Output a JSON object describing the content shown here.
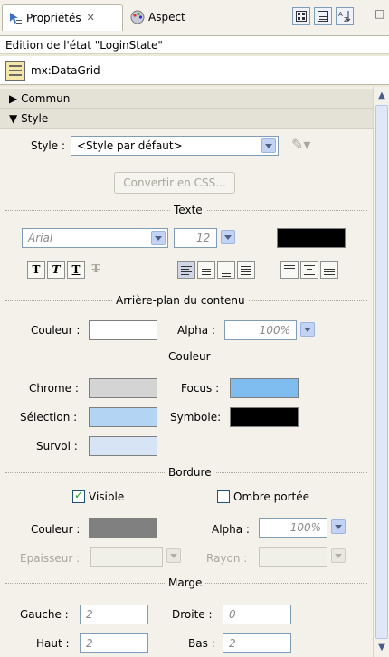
{
  "tabs": [
    {
      "label": "Propriétés",
      "icon": "properties-icon",
      "close_glyph": "✕"
    },
    {
      "label": "Aspect",
      "icon": "appearance-icon"
    }
  ],
  "toolbar_icons": [
    "standard-view-icon",
    "category-view-icon",
    "alpha-sort-icon"
  ],
  "window_controls": {
    "minimize": "–",
    "maximize": "□"
  },
  "state_label": "Edition de l'état  \"LoginState\"",
  "component": {
    "name": "mx:DataGrid",
    "icon": "datagrid-icon"
  },
  "sections": {
    "commun": "Commun",
    "style": "Style"
  },
  "style_row": {
    "label": "Style :",
    "value": "<Style par défaut>"
  },
  "convert_button": "Convertir en CSS...",
  "text_group": {
    "header": "Texte",
    "font": "Arial",
    "size": "12",
    "color": "#000000",
    "format_buttons": [
      "T",
      "T",
      "T",
      "T"
    ]
  },
  "bg_group": {
    "header": "Arrière-plan du contenu",
    "color_label": "Couleur :",
    "color": "#ffffff",
    "alpha_label": "Alpha :",
    "alpha_value": "100%"
  },
  "color_group": {
    "header": "Couleur",
    "chrome_label": "Chrome :",
    "chrome_color": "#d4d4d4",
    "focus_label": "Focus :",
    "focus_color": "#7fbdf0",
    "selection_label": "Sélection :",
    "selection_color": "#b4d4f4",
    "symbole_label": "Symbole:",
    "symbole_color": "#000000",
    "survol_label": "Survol :",
    "survol_color": "#d6e4f6"
  },
  "border_group": {
    "header": "Bordure",
    "visible_label": "Visible",
    "visible_checked": true,
    "shadow_label": "Ombre portée",
    "shadow_checked": false,
    "color_label": "Couleur :",
    "color": "#808080",
    "alpha_label": "Alpha :",
    "alpha_value": "100%",
    "thickness_label": "Epaisseur :",
    "radius_label": "Rayon :"
  },
  "margin_group": {
    "header": "Marge",
    "left_label": "Gauche :",
    "left_value": "2",
    "right_label": "Droite :",
    "right_value": "0",
    "top_label": "Haut :",
    "top_value": "2",
    "bottom_label": "Bas :",
    "bottom_value": "2"
  }
}
